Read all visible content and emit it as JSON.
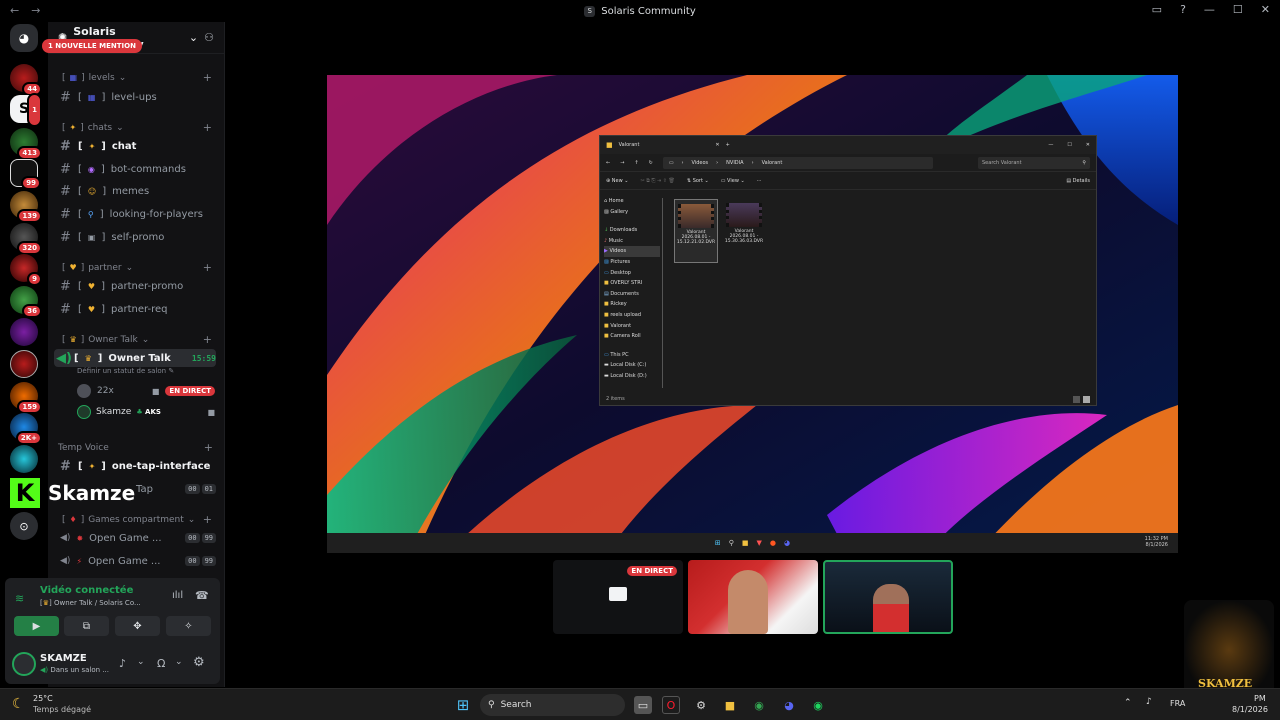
{
  "window": {
    "title": "Solaris Community"
  },
  "server": {
    "name": "Solaris Community",
    "mention_pill": "1 NOUVELLE MENTION"
  },
  "guild_badges": [
    "44",
    "1",
    "413",
    "99",
    "139",
    "320",
    "9",
    "36",
    "159",
    "2K+"
  ],
  "categories": {
    "levels": "levels",
    "chats": "chats",
    "partner": "partner",
    "owner": "Owner Talk",
    "temp": "Temp Voice",
    "games": "Games compartment"
  },
  "channels": {
    "level_ups": "level-ups",
    "chat": "chat",
    "bot_commands": "bot-commands",
    "memes": "memes",
    "looking": "looking-for-players",
    "self_promo": "self-promo",
    "partner_promo": "partner-promo",
    "partner_req": "partner-req",
    "owner_talk": "Owner Talk",
    "owner_talk_time": "15:59",
    "owner_status": "Définir un statut de salon",
    "one_tap": "one-tap-interface",
    "tap": "Tap",
    "open_game_1": "Open Game ...",
    "open_game_2": "Open Game ..."
  },
  "voice_users": {
    "u1": "22x",
    "u1_live": "EN DIRECT",
    "u2": "Skamze",
    "u2_tag": "AKS"
  },
  "counters": {
    "tap_a": "00",
    "tap_b": "01",
    "g1_a": "00",
    "g1_b": "99",
    "g2_a": "00",
    "g2_b": "99"
  },
  "overlay": {
    "streamer": "Skamze"
  },
  "voice_panel": {
    "status": "Vidéo connectée",
    "location": "Owner Talk / Solaris Co...",
    "user": "SKAMZE",
    "user_status": "Dans un salon ..."
  },
  "explorer": {
    "tab": "Valorant",
    "path": [
      "Videos",
      "NVIDIA",
      "Valorant"
    ],
    "search_placeholder": "Search Valorant",
    "toolbar": [
      "New",
      "Sort",
      "View",
      "Details"
    ],
    "sidebar": [
      "Home",
      "Gallery",
      "Downloads",
      "Music",
      "Videos",
      "Pictures",
      "Desktop",
      "OVERLY STRI",
      "Documents",
      "Rickey",
      "reels upload",
      "Valorant",
      "Camera Roll",
      "This PC",
      "Local Disk (C:)",
      "Local Disk (D:)"
    ],
    "files": [
      {
        "name": "Valorant 2026.08.01 - 15.12.21.02.DVR"
      },
      {
        "name": "Valorant 2026.08.01 - 15.30.36.03.DVR"
      }
    ],
    "status": "2 items",
    "clock_time": "11:32 PM",
    "clock_date": "8/1/2026"
  },
  "tiles": {
    "live": "EN DIRECT"
  },
  "taskbar": {
    "temp": "25°C",
    "weather": "Temps dégagé",
    "search": "Search",
    "lang": "FRA",
    "time": "PM",
    "date": "8/1/2026",
    "watermark": "SKAMZE"
  },
  "colors": {
    "accent": "#5865f2",
    "live": "#da373c",
    "online": "#23a55a"
  }
}
